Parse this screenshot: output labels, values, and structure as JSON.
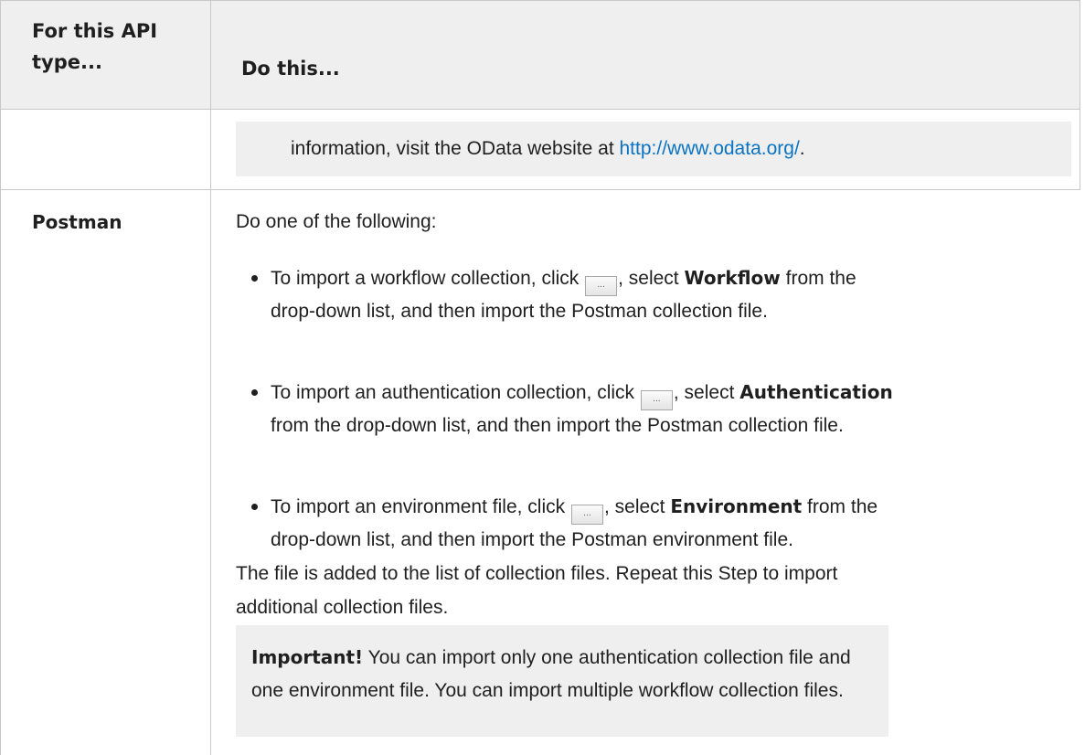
{
  "table": {
    "headers": {
      "col1": "For this API type...",
      "col2": "Do this..."
    },
    "continued_row": {
      "note_text": "information, visit the OData website at ",
      "note_link": "http://www.odata.org/",
      "note_trailing": "."
    },
    "postman_row": {
      "api_type": "Postman",
      "intro": "Do one of the following:",
      "bullets": [
        {
          "before_button": "To import a workflow collection, click ",
          "after_button": ", select ",
          "bold": "Workflow",
          "after_bold": " from the",
          "line2": "drop-down list, and then import the Postman collection file."
        },
        {
          "before_button": "To import an authentication collection, click ",
          "after_button": ", select ",
          "bold": "Authentication",
          "after_bold": "",
          "line2": "from the drop-down list, and then import the Postman collection file."
        },
        {
          "before_button": "To import an environment file, click ",
          "after_button": ", select ",
          "bold": "Environment",
          "after_bold": " from the",
          "line2": "drop-down list, and then import the Postman environment file."
        }
      ],
      "browse_button_label": "...",
      "paragraph_line1": "The file is added to the list of collection files. Repeat this Step to import",
      "paragraph_line2": "additional collection files.",
      "important": {
        "label": "Important!",
        "line1_rest": " You can import only one authentication collection file and",
        "line2": "one environment file. You can import multiple workflow collection files."
      }
    }
  }
}
